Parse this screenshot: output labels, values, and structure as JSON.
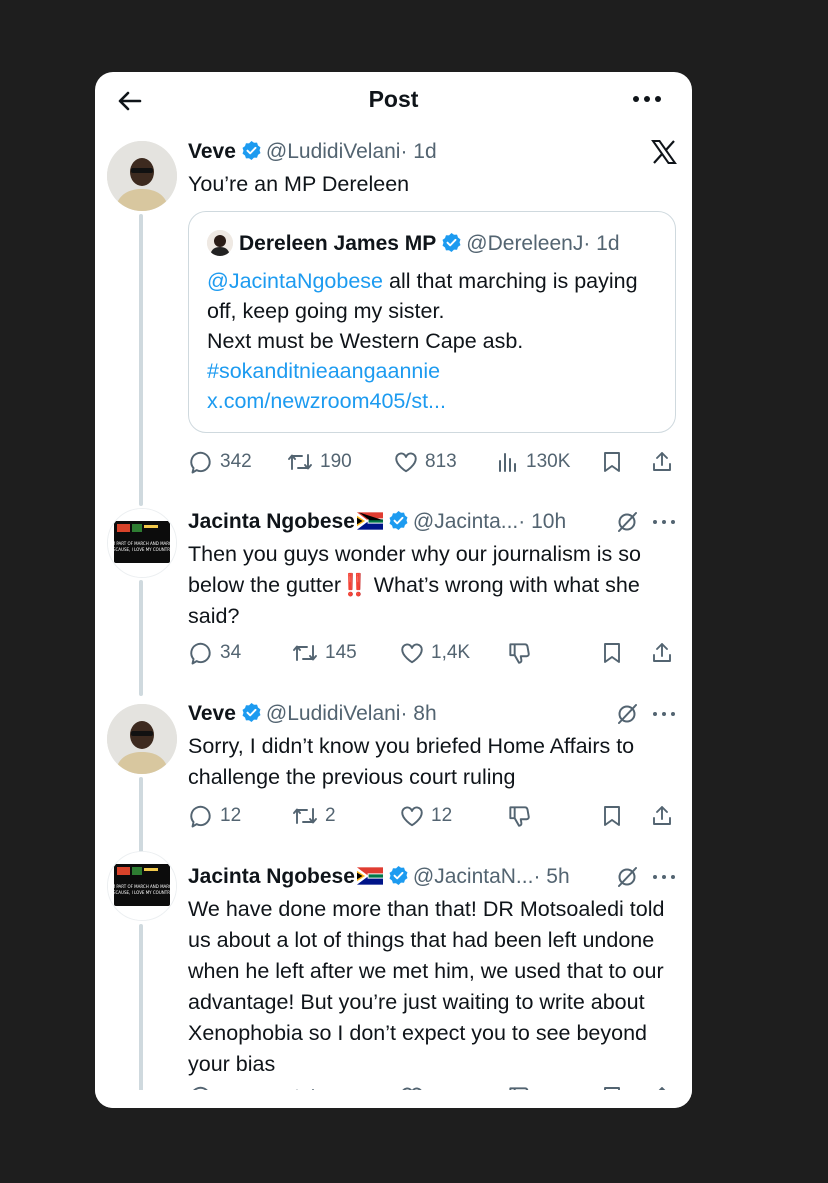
{
  "header": {
    "title": "Post"
  },
  "tweets": [
    {
      "name": "Veve",
      "handle": "@LudidiVelani",
      "time": "· 1d",
      "text": "You’re an MP Dereleen",
      "quote": {
        "name": "Dereleen James MP",
        "handle": "@DereleenJ",
        "time": "· 1d",
        "mention": "@JacintaNgobese",
        "text_after_mention": " all that marching is paying off, keep going my sister.",
        "line2": "Next must be Western Cape asb.",
        "hashtag": "#sokanditnieaangaannie",
        "url": "x.com/newzroom405/st..."
      },
      "stats": {
        "replies": "342",
        "reposts": "190",
        "likes": "813",
        "views": "130K"
      }
    },
    {
      "name": "Jacinta Ngobese",
      "handle": "@Jacinta...",
      "time": "· 10h",
      "text_before_emoji": "Then you guys wonder why our journalism is so below the gutter",
      "emoji": "‼️",
      "text_after_emoji": " What’s wrong with what she said?",
      "stats": {
        "replies": "34",
        "reposts": "145",
        "likes": "1,4K"
      }
    },
    {
      "name": "Veve",
      "handle": "@LudidiVelani",
      "time": "· 8h",
      "text": "Sorry, I didn’t know you briefed Home Affairs to challenge the previous court ruling",
      "stats": {
        "replies": "12",
        "reposts": "2",
        "likes": "12"
      }
    },
    {
      "name": "Jacinta Ngobese",
      "handle": "@JacintaN...",
      "time": "· 5h",
      "text": "We have done more than that! DR Motsoaledi told us about a lot of things that had been left undone when he left after we met him, we used that to our advantage! But you’re just waiting to write about Xenophobia so I don’t expect you to see beyond your bias"
    }
  ],
  "avatar_texts": {
    "banner_line1": "I'M PART OF MARCH AND MARCH",
    "banner_line2": "BECAUSE, I LOVE MY COUNTRY!"
  },
  "colors": {
    "accent": "#1d9bf0",
    "text": "#0f1419",
    "muted": "#536471",
    "border": "#cfd9de",
    "background": "#1e1e1e"
  }
}
